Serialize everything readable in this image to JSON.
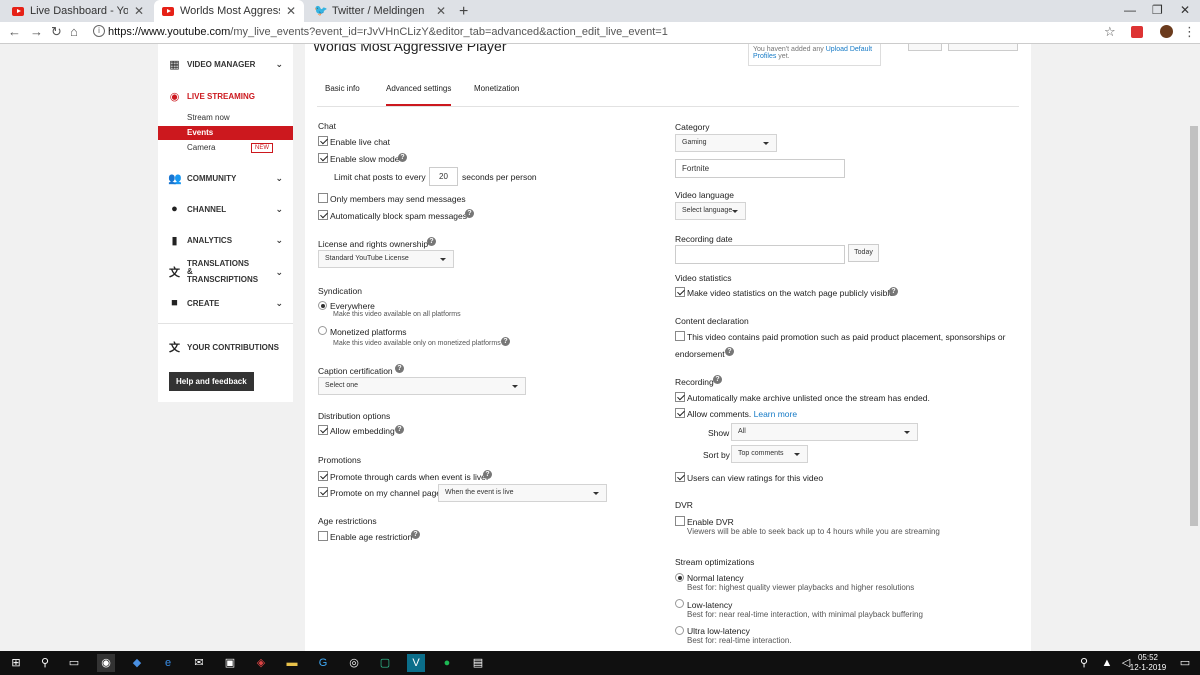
{
  "browser": {
    "tabs": [
      {
        "title": "Live Dashboard - YouTube",
        "icon": "youtube-icon"
      },
      {
        "title": "Worlds Most Aggressive Player -",
        "icon": "youtube-icon"
      },
      {
        "title": "Twitter / Meldingen",
        "icon": "twitter-icon"
      }
    ],
    "url_host": "https://www.youtube.com",
    "url_path": "/my_live_events?event_id=rJvVHnCLizY&editor_tab=advanced&action_edit_live_event=1"
  },
  "sidebar": {
    "video_manager": "VIDEO MANAGER",
    "live_streaming": "LIVE STREAMING",
    "stream_now": "Stream now",
    "events": "Events",
    "camera": "Camera",
    "camera_badge": "NEW",
    "community": "COMMUNITY",
    "channel": "CHANNEL",
    "analytics": "ANALYTICS",
    "translations": "TRANSLATIONS & TRANSCRIPTIONS",
    "create": "CREATE",
    "your_contributions": "YOUR CONTRIBUTIONS",
    "help": "Help and feedback"
  },
  "header": {
    "title": "Worlds Most Aggressive Player",
    "defaults_text": "You haven't added any",
    "defaults_link": "Upload Default Profiles",
    "defaults_suffix": "yet."
  },
  "tabs": {
    "basic": "Basic info",
    "advanced": "Advanced settings",
    "monetization": "Monetization"
  },
  "left": {
    "chat": "Chat",
    "enable_live_chat": "Enable live chat",
    "enable_slow_mode": "Enable slow mode",
    "limit_prefix": "Limit chat posts to every",
    "limit_value": "20",
    "limit_suffix": "seconds per person",
    "members_only": "Only members may send messages",
    "block_spam": "Automatically block spam messages",
    "license": "License and rights ownership",
    "license_value": "Standard YouTube License",
    "syndication": "Syndication",
    "everywhere": "Everywhere",
    "everywhere_hint": "Make this video available on all platforms",
    "monetized": "Monetized platforms",
    "monetized_hint": "Make this video available only on monetized platforms",
    "caption": "Caption certification",
    "caption_value": "Select one",
    "distribution": "Distribution options",
    "allow_embedding": "Allow embedding",
    "promotions": "Promotions",
    "promote_cards": "Promote through cards when event is live.",
    "promote_channel": "Promote on my channel page",
    "promote_channel_value": "When the event is live",
    "age": "Age restrictions",
    "enable_age": "Enable age restriction"
  },
  "right": {
    "category": "Category",
    "category_value": "Gaming",
    "game_value": "Fortnite",
    "video_language": "Video language",
    "language_value": "Select language",
    "recording_date": "Recording date",
    "today": "Today",
    "video_statistics": "Video statistics",
    "stats_public": "Make video statistics on the watch page publicly visible",
    "content_declaration": "Content declaration",
    "paid_promo_1": "This video contains paid promotion such as paid product placement, sponsorships or",
    "paid_promo_2": "endorsement",
    "recording": "Recording",
    "archive_unlisted": "Automatically make archive unlisted once the stream has ended.",
    "allow_comments": "Allow comments.",
    "learn_more": "Learn more",
    "show": "Show",
    "show_value": "All",
    "sort_by": "Sort by",
    "sort_value": "Top comments",
    "ratings": "Users can view ratings for this video",
    "dvr": "DVR",
    "enable_dvr": "Enable DVR",
    "dvr_hint": "Viewers will be able to seek back up to 4 hours while you are streaming",
    "stream_opt": "Stream optimizations",
    "normal": "Normal latency",
    "normal_hint": "Best for: highest quality viewer playbacks and higher resolutions",
    "low": "Low-latency",
    "low_hint": "Best for: near real-time interaction, with minimal playback buffering",
    "ultra": "Ultra low-latency",
    "ultra_hint": "Best for: real-time interaction."
  },
  "taskbar": {
    "time": "05:52",
    "date": "12-1-2019"
  },
  "colors": {
    "accent": "#cc181e",
    "link": "#167ac6"
  }
}
